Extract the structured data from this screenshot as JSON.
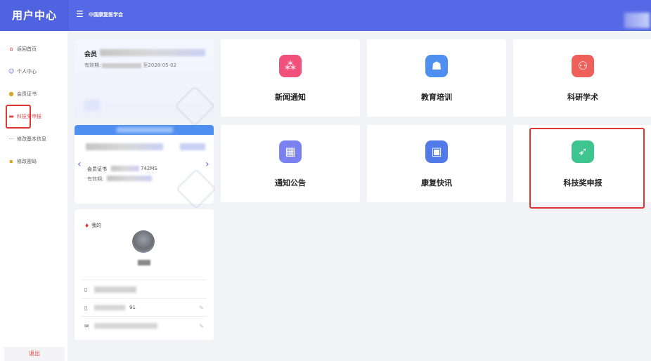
{
  "header": {
    "brand": "用户中心",
    "menu_icon": "menu-icon",
    "org_name": "中国康复医学会"
  },
  "sidebar": {
    "items": [
      {
        "label": "返回首页",
        "icon": "home-icon"
      },
      {
        "label": "个人中心",
        "icon": "user-icon"
      },
      {
        "label": "会员证书",
        "icon": "certificate-icon"
      },
      {
        "label": "科技奖申报",
        "icon": "award-icon",
        "active": true
      },
      {
        "label": "修改基本信息",
        "icon": "edit-icon"
      },
      {
        "label": "修改密码",
        "icon": "lock-icon"
      }
    ],
    "logout": "退出"
  },
  "member_card": {
    "name_prefix": "会员",
    "valid_prefix": "有效期:",
    "valid_until": "至2028-05-02"
  },
  "certificate_card": {
    "cert_label": "会员证书",
    "cert_no_suffix": "742MS",
    "valid_prefix": "有效期:"
  },
  "profile_card": {
    "title": "我的",
    "phone_suffix": "91"
  },
  "tiles": [
    {
      "label": "新闻通知",
      "icon": "news-icon",
      "color": "#f0507a"
    },
    {
      "label": "教育培训",
      "icon": "education-icon",
      "color": "#4f8ff0"
    },
    {
      "label": "科研学术",
      "icon": "research-icon",
      "color": "#f0605a"
    },
    {
      "label": "通知公告",
      "icon": "calendar-icon",
      "color": "#7b82f0"
    },
    {
      "label": "康复快讯",
      "icon": "flash-news-icon",
      "color": "#4f7ae8"
    },
    {
      "label": "科技奖申报",
      "icon": "rocket-icon",
      "color": "#3ec48e"
    }
  ],
  "colors": {
    "accent": "#5568e6",
    "highlight": "#e0352f"
  }
}
